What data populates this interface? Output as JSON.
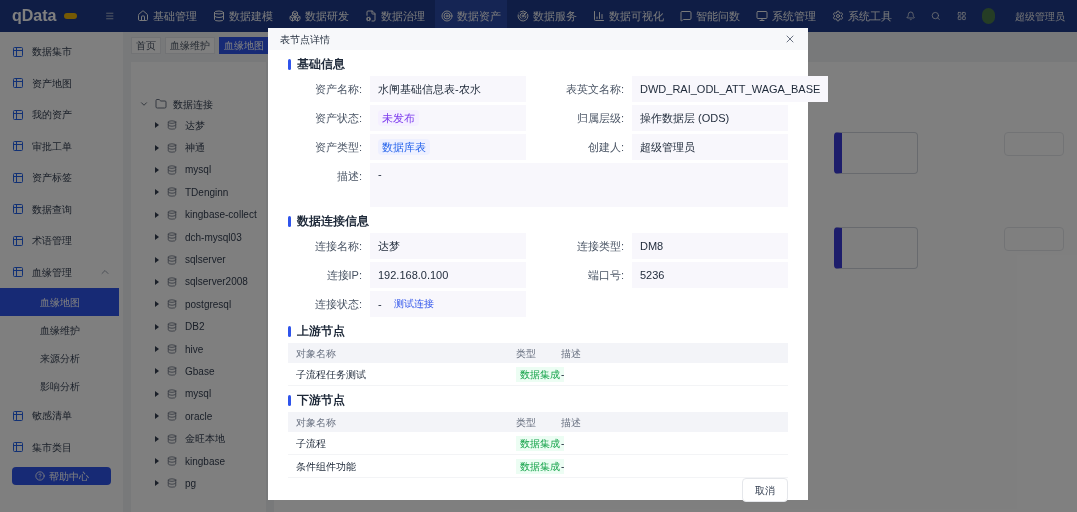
{
  "nav": {
    "logo": "qData",
    "items": [
      {
        "label": "基础管理",
        "selected": false
      },
      {
        "label": "数据建模",
        "selected": false
      },
      {
        "label": "数据研发",
        "selected": false
      },
      {
        "label": "数据治理",
        "selected": false
      },
      {
        "label": "数据资产",
        "selected": true
      },
      {
        "label": "数据服务",
        "selected": false
      },
      {
        "label": "数据可视化",
        "selected": false
      },
      {
        "label": "智能问数",
        "selected": false
      },
      {
        "label": "系统管理",
        "selected": false
      },
      {
        "label": "系统工具",
        "selected": false
      }
    ],
    "user": "超级管理员"
  },
  "sidebar": {
    "items": [
      {
        "label": "数据集市"
      },
      {
        "label": "资产地图"
      },
      {
        "label": "我的资产"
      },
      {
        "label": "审批工单"
      },
      {
        "label": "资产标签"
      },
      {
        "label": "数据查询"
      },
      {
        "label": "术语管理"
      },
      {
        "label": "血缘管理",
        "expanded": true,
        "children": [
          {
            "label": "血缘地图",
            "selected": true
          },
          {
            "label": "血缘维护",
            "selected": false
          },
          {
            "label": "来源分析",
            "selected": false
          },
          {
            "label": "影响分析",
            "selected": false
          }
        ]
      },
      {
        "label": "敏感清单"
      },
      {
        "label": "集市类目"
      }
    ],
    "help_button": "帮助中心"
  },
  "tabs": [
    {
      "label": "首页",
      "selected": false
    },
    {
      "label": "血缘维护",
      "selected": false
    },
    {
      "label": "血缘地图",
      "selected": true
    }
  ],
  "tree": {
    "label": "数据连接",
    "expanded": true,
    "children": [
      {
        "label": "达梦",
        "expanded": false
      },
      {
        "label": "神通",
        "expanded": false
      },
      {
        "label": "mysql",
        "expanded": false
      },
      {
        "label": "TDenginn",
        "expanded": false
      },
      {
        "label": "kingbase-collect",
        "expanded": false
      },
      {
        "label": "dch-mysql03",
        "expanded": false
      },
      {
        "label": "sqlserver",
        "expanded": false
      },
      {
        "label": "sqlserver2008",
        "expanded": false
      },
      {
        "label": "postgresql",
        "expanded": false
      },
      {
        "label": "DB2",
        "expanded": false
      },
      {
        "label": "hive",
        "expanded": false
      },
      {
        "label": "Gbase",
        "expanded": false
      },
      {
        "label": "mysql",
        "expanded": false
      },
      {
        "label": "oracle",
        "expanded": false
      },
      {
        "label": "金旺本地",
        "expanded": false
      },
      {
        "label": "kingbase",
        "expanded": false
      },
      {
        "label": "pg",
        "expanded": false
      }
    ]
  },
  "dialog": {
    "title": "表节点详情",
    "sections": [
      {
        "kind": "fields",
        "title": "基础信息",
        "fields": [
          {
            "label": "资产名称:",
            "value": "水闸基础信息表-农水",
            "kind": "text"
          },
          {
            "label": "表英文名称:",
            "value": "DWD_RAI_ODL_ATT_WAGA_BASE",
            "kind": "text"
          },
          {
            "label": "资产状态:",
            "value": "未发布",
            "kind": "status"
          },
          {
            "label": "归属层级:",
            "value": "操作数据层 (ODS)",
            "kind": "text"
          },
          {
            "label": "资产类型:",
            "value": "数据库表",
            "kind": "category"
          },
          {
            "label": "创建人:",
            "value": "超级管理员",
            "kind": "text"
          },
          {
            "label": "描述:",
            "value": "-",
            "kind": "wide"
          }
        ]
      },
      {
        "kind": "fields",
        "title": "数据连接信息",
        "fields": [
          {
            "label": "连接名称:",
            "value": "达梦",
            "kind": "text"
          },
          {
            "label": "连接类型:",
            "value": "DM8",
            "kind": "text"
          },
          {
            "label": "连接IP:",
            "value": "192.168.0.100",
            "kind": "text"
          },
          {
            "label": "端口号:",
            "value": "5236",
            "kind": "text"
          },
          {
            "label": "连接状态:",
            "value": "-",
            "kind": "link",
            "link": "测试连接"
          }
        ]
      },
      {
        "kind": "table",
        "title": "上游节点",
        "columns": [
          "对象名称",
          "类型",
          "描述"
        ],
        "rows": [
          {
            "name": "子流程任务测试",
            "type": "数据集成",
            "desc": "-"
          }
        ]
      },
      {
        "kind": "table",
        "title": "下游节点",
        "columns": [
          "对象名称",
          "类型",
          "描述"
        ],
        "rows": [
          {
            "name": "子流程",
            "type": "数据集成",
            "desc": "-"
          },
          {
            "name": "条件组件功能",
            "type": "数据集成",
            "desc": "-"
          }
        ]
      }
    ],
    "cancel_button": "取消"
  }
}
